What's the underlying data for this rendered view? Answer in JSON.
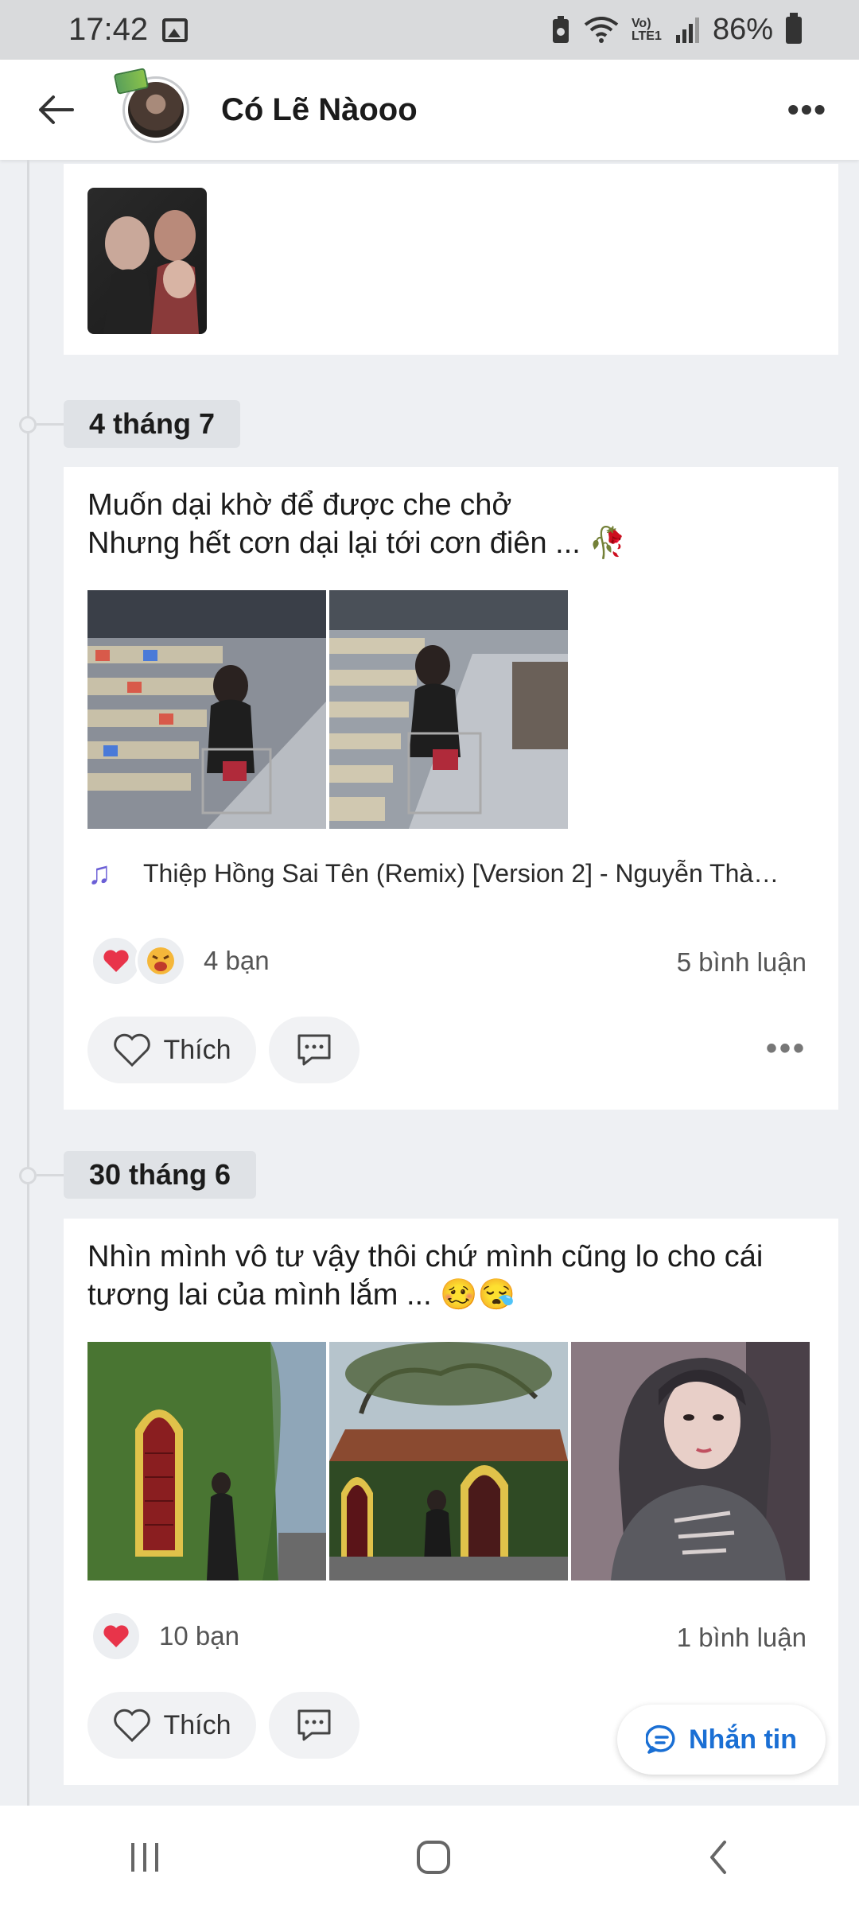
{
  "status_bar": {
    "time": "17:42",
    "network": "Vo) LTE1",
    "battery": "86%"
  },
  "header": {
    "title": "Có Lẽ Nàooo"
  },
  "posts": [
    {
      "date": "4 tháng 7",
      "text_line1": "Muốn dại khờ để được che chở",
      "text_line2": "Nhưng hết cơn dại lại tới cơn điên ... 🥀",
      "song": "Thiệp Hồng Sai Tên (Remix) [Version 2] - Nguyễn Thà…",
      "reactions_count": "4 bạn",
      "comments_count": "5 bình luận",
      "like_label": "Thích"
    },
    {
      "date": "30 tháng 6",
      "text_line1": "Nhìn mình vô tư vậy thôi chứ mình cũng lo cho cái",
      "text_line2": "tương lai của mình lắm ... 🥴😪",
      "reactions_count": "10 bạn",
      "comments_count": "1 bình luận",
      "like_label": "Thích"
    }
  ],
  "message_button": {
    "label": "Nhắn tin"
  },
  "colors": {
    "accent": "#1a6fd4",
    "heart": "#e8344a",
    "music": "#6b5fd6"
  }
}
